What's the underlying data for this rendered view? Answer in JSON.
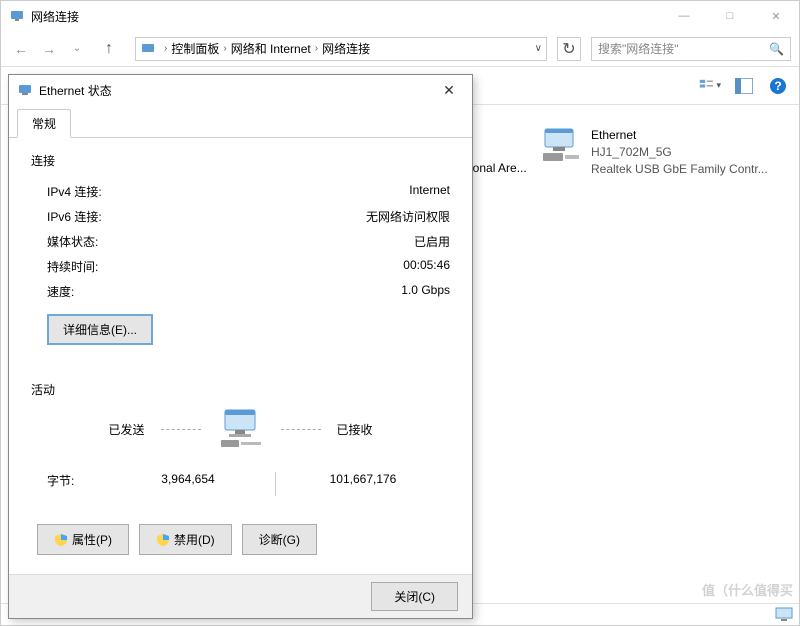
{
  "window": {
    "title": "网络连接",
    "minimize": "—",
    "maximize": "□",
    "close": "✕"
  },
  "nav": {
    "back": "←",
    "forward": "→",
    "up": "↑",
    "refresh": "↻",
    "search_placeholder": "搜索\"网络连接\"",
    "search_icon": "🔍"
  },
  "breadcrumb": {
    "seg1": "控制面板",
    "seg2": "网络和 Internet",
    "seg3": "网络连接",
    "sep": "›",
    "dd": "∨"
  },
  "toolbar": {
    "view_icon": "≣",
    "layout_icon": "▥",
    "help_icon": "?"
  },
  "connections": {
    "truncated": {
      "label": "ersonal Are..."
    },
    "ethernet": {
      "name": "Ethernet",
      "net": "HJ1_702M_5G",
      "device": "Realtek USB GbE Family Contr..."
    }
  },
  "dialog": {
    "title": "Ethernet 状态",
    "close": "✕",
    "tab_general": "常规",
    "section_connection": "连接",
    "ipv4_label": "IPv4 连接:",
    "ipv4_value": "Internet",
    "ipv6_label": "IPv6 连接:",
    "ipv6_value": "无网络访问权限",
    "media_label": "媒体状态:",
    "media_value": "已启用",
    "duration_label": "持续时间:",
    "duration_value": "00:05:46",
    "speed_label": "速度:",
    "speed_value": "1.0 Gbps",
    "details_btn": "详细信息(E)...",
    "section_activity": "活动",
    "sent_label": "已发送",
    "received_label": "已接收",
    "bytes_label": "字节:",
    "bytes_sent": "3,964,654",
    "bytes_recv": "101,667,176",
    "properties_btn": "属性(P)",
    "disable_btn": "禁用(D)",
    "diagnose_btn": "诊断(G)",
    "close_btn": "关闭(C)"
  },
  "watermark": "值（什么值得买"
}
